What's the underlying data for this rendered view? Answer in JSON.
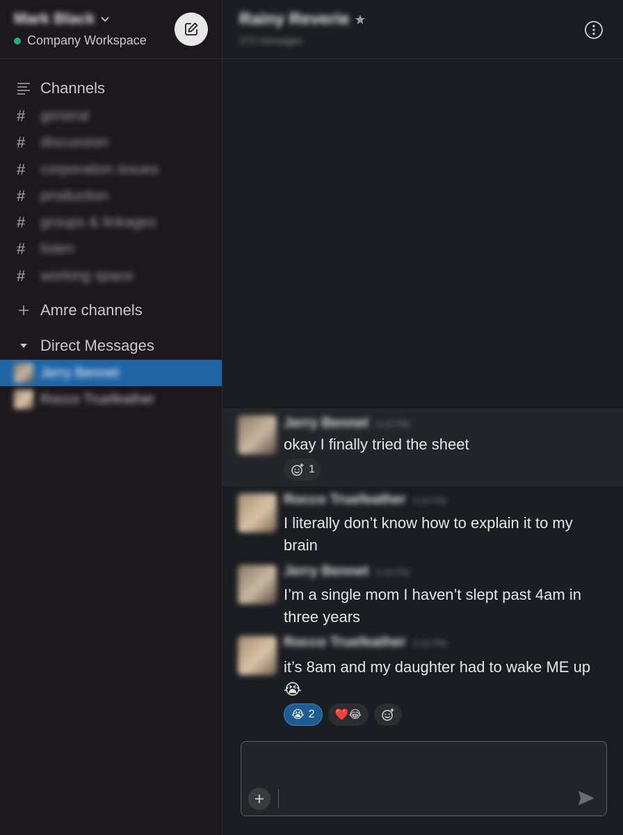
{
  "workspace": {
    "name": "Mark Black",
    "subtitle": "Company Workspace",
    "status_color": "#2bac76"
  },
  "sidebar": {
    "channels_label": "Channels",
    "channels": [
      {
        "name": "general"
      },
      {
        "name": "discussion"
      },
      {
        "name": "corporation issues"
      },
      {
        "name": "production"
      },
      {
        "name": "groups & linkages"
      },
      {
        "name": "listen"
      },
      {
        "name": "working space"
      }
    ],
    "add_channels_label": "Amre channels",
    "dm_label": "Direct Messages",
    "dms": [
      {
        "name": "Jerry Bennet",
        "active": true
      },
      {
        "name": "Rocco Truefeather",
        "active": false
      }
    ]
  },
  "conversation": {
    "title": "Rainy Reverie",
    "subtitle": "273 messages"
  },
  "messages": [
    {
      "author": "Jerry Bennet",
      "time": "4:10 PM",
      "text": "okay I finally tried the sheet"
    },
    {
      "author": "Rocco Truefeather",
      "time": "4:10 PM",
      "text": "I literally don’t know how to explain it to my brain"
    },
    {
      "author": "Jerry Bennet",
      "time": "4:10 PM",
      "text": "I’m a single mom I haven’t slept past 4am in three years"
    },
    {
      "author": "Rocco Truefeather",
      "time": "4:10 PM",
      "text": "it’s 8am and my daughter had to wake ME up"
    }
  ],
  "reactions": {
    "msg1_add_count": "1",
    "msg4": [
      {
        "emoji": "😭",
        "count": "2",
        "mine": true
      },
      {
        "emoji": "❤️😂",
        "count": "",
        "mine": false
      }
    ],
    "msg4_inline_emoji": "😭"
  },
  "composer": {
    "placeholder": ""
  },
  "colors": {
    "sidebar_bg": "#1c181d",
    "main_bg": "#1a1d21",
    "active_item": "#1f65a6"
  }
}
